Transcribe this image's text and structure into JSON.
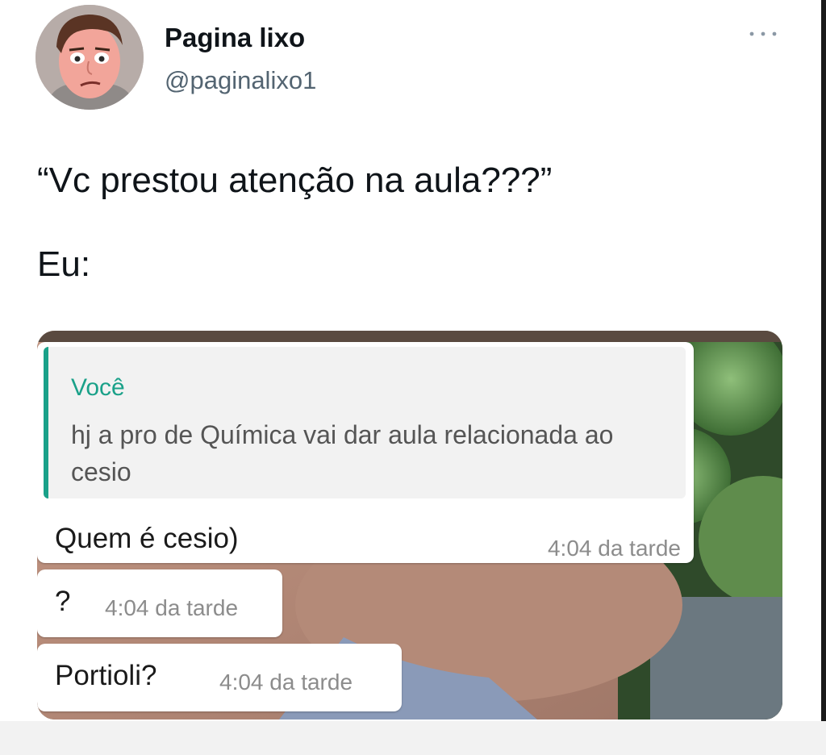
{
  "tweet": {
    "author_name": "Pagina lixo",
    "author_handle": "@paginalixo1",
    "more_icon": "more-horizontal-icon",
    "text_line1": "“Vc prestou atenção na aula???”",
    "text_line2": "Eu:"
  },
  "chat": {
    "messages": [
      {
        "quote_author": "Você",
        "quote_text": "hj a pro de Química vai dar aula relacionada ao cesio",
        "text": "Quem é cesio)",
        "time": "4:04 da tarde"
      },
      {
        "text": "?",
        "time": "4:04 da tarde"
      },
      {
        "text": "Portioli?",
        "time": "4:04 da tarde"
      }
    ]
  },
  "colors": {
    "quote_accent": "#1aa189",
    "timestamp": "#8c8c8c",
    "handle": "#536471"
  }
}
